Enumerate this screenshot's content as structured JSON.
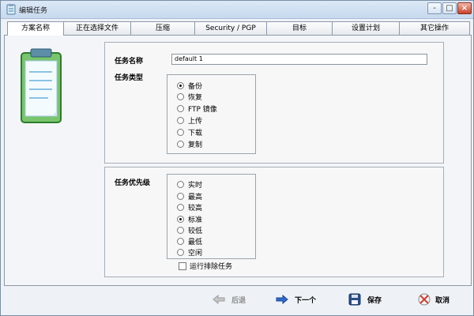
{
  "window": {
    "title": "编辑任务",
    "controls": {
      "minimize": "-",
      "maximize": "□",
      "close": "×"
    }
  },
  "tabs": [
    {
      "label": "方案名称",
      "active": true
    },
    {
      "label": "正在选择文件",
      "active": false
    },
    {
      "label": "压缩",
      "active": false
    },
    {
      "label": "Security / PGP",
      "active": false
    },
    {
      "label": "目标",
      "active": false
    },
    {
      "label": "设置计划",
      "active": false
    },
    {
      "label": "其它操作",
      "active": false
    }
  ],
  "task": {
    "name_label": "任务名称",
    "name_value": "default 1",
    "type_label": "任务类型",
    "types": [
      {
        "label": "备份",
        "selected": true
      },
      {
        "label": "恢复",
        "selected": false
      },
      {
        "label": "FTP 镜像",
        "selected": false
      },
      {
        "label": "上传",
        "selected": false
      },
      {
        "label": "下载",
        "selected": false
      },
      {
        "label": "复制",
        "selected": false
      }
    ]
  },
  "priority": {
    "label": "任务优先级",
    "options": [
      {
        "label": "实时",
        "selected": false
      },
      {
        "label": "最高",
        "selected": false
      },
      {
        "label": "较高",
        "selected": false
      },
      {
        "label": "标准",
        "selected": true
      },
      {
        "label": "较低",
        "selected": false
      },
      {
        "label": "最低",
        "selected": false
      },
      {
        "label": "空闲",
        "selected": false
      }
    ],
    "run_exclusive_label": "运行排除任务",
    "run_exclusive_checked": false
  },
  "footer": {
    "back": "后退",
    "next": "下一个",
    "save": "保存",
    "cancel": "取消"
  },
  "icons": {
    "app": "clipboard-icon",
    "back": "arrow-left-icon",
    "next": "arrow-right-icon",
    "save": "save-icon",
    "cancel": "cancel-icon"
  }
}
